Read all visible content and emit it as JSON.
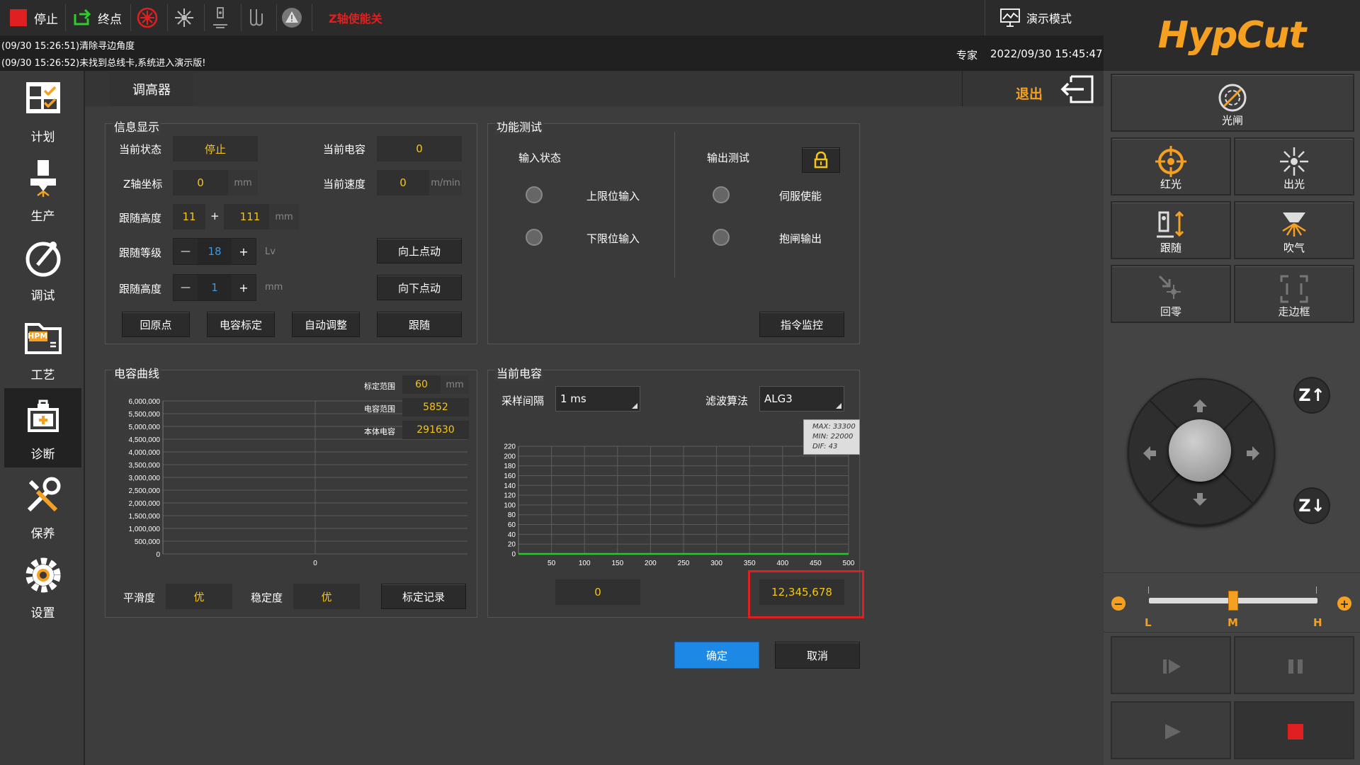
{
  "topbar": {
    "stop_label": "停止",
    "end_label": "终点",
    "z_enable_label": "Z轴使能关",
    "demo_label": "演示模式"
  },
  "log": {
    "line1": "(09/30 15:26:51)清除寻边角度",
    "line2": "(09/30 15:26:52)未找到总线卡,系统进入演示版!",
    "user": "专家",
    "datetime": "2022/09/30 15:45:47"
  },
  "sidebar": {
    "items": [
      {
        "label": "计划"
      },
      {
        "label": "生产"
      },
      {
        "label": "调试"
      },
      {
        "label": "工艺"
      },
      {
        "label": "诊断"
      },
      {
        "label": "保养"
      },
      {
        "label": "设置"
      }
    ],
    "hpm_text": "HPM"
  },
  "logo": {
    "text": "HypCut"
  },
  "right": {
    "shutter": "光闸",
    "red_light": "红光",
    "laser": "出光",
    "follow": "跟随",
    "blow": "吹气",
    "home": "回零",
    "frame": "走边框",
    "z_up": "Z↑",
    "z_down": "Z↓",
    "speed_l": "L",
    "speed_m": "M",
    "speed_h": "H",
    "speed_level": 0.5
  },
  "tab": {
    "title": "调高器",
    "exit": "退出"
  },
  "info": {
    "title": "信息显示",
    "state_label": "当前状态",
    "state_value": "停止",
    "cap_label": "当前电容",
    "cap_value": "0",
    "z_label": "Z轴坐标",
    "z_value": "0",
    "z_unit": "mm",
    "speed_label": "当前速度",
    "speed_value": "0",
    "speed_unit": "m/min",
    "follow_h_label": "跟随高度",
    "follow_h_a": "11",
    "plus": "+",
    "follow_h_b": "111",
    "follow_h_unit": "mm",
    "level_label": "跟随等级",
    "level_minus": "—",
    "level_value": "18",
    "level_plus": "+",
    "level_unit": "Lv",
    "height2_label": "跟随高度",
    "height2_minus": "—",
    "height2_value": "1",
    "height2_plus": "+",
    "height2_unit": "mm",
    "jog_up": "向上点动",
    "jog_down": "向下点动",
    "btn_home": "回原点",
    "btn_calib": "电容标定",
    "btn_auto": "自动调整",
    "btn_follow": "跟随"
  },
  "func": {
    "title": "功能测试",
    "input_title": "输入状态",
    "upper_limit": "上限位输入",
    "lower_limit": "下限位输入",
    "output_title": "输出测试",
    "servo": "伺服使能",
    "brake": "抱闸输出",
    "monitor": "指令监控"
  },
  "capcurve": {
    "title": "电容曲线",
    "range_label": "标定范围",
    "range_value": "60",
    "range_unit": "mm",
    "cap_range_label": "电容范围",
    "cap_range_value": "5852",
    "body_cap_label": "本体电容",
    "body_cap_value": "291630",
    "smooth_label": "平滑度",
    "smooth_value": "优",
    "stable_label": "稳定度",
    "stable_value": "优",
    "record_btn": "标定记录"
  },
  "curcap": {
    "title": "当前电容",
    "interval_label": "采样间隔",
    "interval_value": "1 ms",
    "filter_label": "滤波算法",
    "filter_value": "ALG3",
    "stats_max": "MAX: 33300",
    "stats_min": "MIN: 22000",
    "stats_dif": "DIF: 43",
    "left_value": "0",
    "right_value": "12,345,678"
  },
  "dialog": {
    "ok": "确定",
    "cancel": "取消"
  },
  "chart_data": [
    {
      "type": "line",
      "title": "",
      "yticks": [
        "6,000,000",
        "5,500,000",
        "5,000,000",
        "4,500,000",
        "4,000,000",
        "3,500,000",
        "3,000,000",
        "2,500,000",
        "2,000,000",
        "1,500,000",
        "1,000,000",
        "500,000",
        "0"
      ],
      "xticks": [
        "0"
      ],
      "ylim": [
        0,
        6000000
      ],
      "series": []
    },
    {
      "type": "line",
      "title": "",
      "xticks": [
        "50",
        "100",
        "150",
        "200",
        "250",
        "300",
        "350",
        "400",
        "450",
        "500"
      ],
      "yticks": [
        "220",
        "200",
        "180",
        "160",
        "140",
        "120",
        "100",
        "80",
        "60",
        "40",
        "20",
        "0"
      ],
      "xlim": [
        0,
        500
      ],
      "ylim": [
        0,
        220
      ],
      "series": [
        {
          "color": "#22cc22",
          "x": [
            0,
            500
          ],
          "y": [
            0,
            0
          ]
        }
      ]
    }
  ],
  "colors": {
    "accent": "#f5c518",
    "ok_blue": "#1e88e5",
    "highlight_red": "#e02020"
  }
}
